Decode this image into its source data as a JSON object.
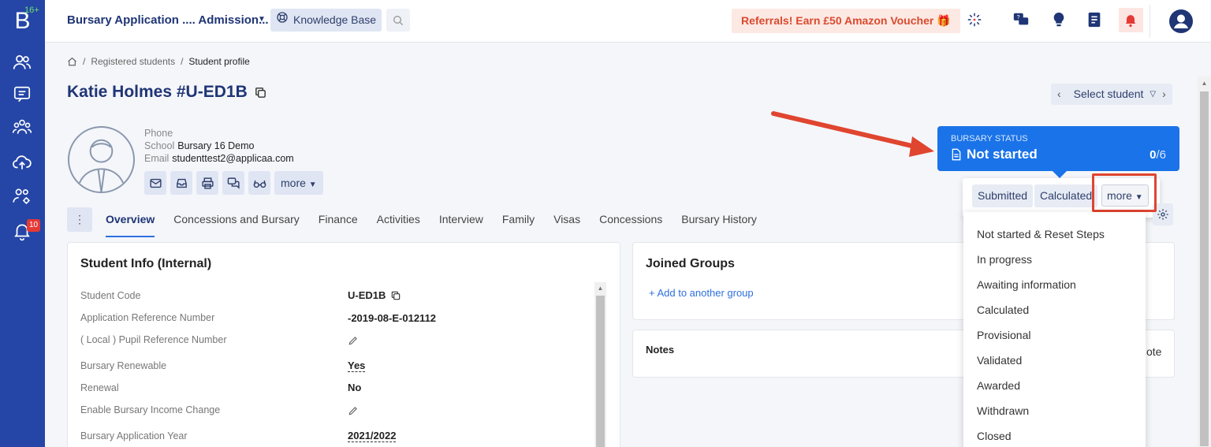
{
  "app": {
    "logo_letter": "B",
    "logo_super": "16+",
    "title": "Bursary Application .... Admission...",
    "kb_label": "Knowledge Base",
    "referral": "Referrals! Earn £50 Amazon Voucher",
    "notif_count": "10"
  },
  "breadcrumb": {
    "items": [
      "Registered students",
      "Student profile"
    ]
  },
  "student": {
    "name": "Katie Holmes #U-ED1B",
    "phone_label": "Phone",
    "school_label": "School",
    "school": "Bursary 16 Demo",
    "email_label": "Email",
    "email": "studenttest2@applicaa.com",
    "more_label": "more"
  },
  "select_student": "Select student",
  "tabs": [
    "Overview",
    "Concessions and Bursary",
    "Finance",
    "Activities",
    "Interview",
    "Family",
    "Visas",
    "Concessions",
    "Bursary History"
  ],
  "student_info": {
    "title": "Student Info (Internal)",
    "rows": [
      {
        "label": "Student Code",
        "value": "U-ED1B"
      },
      {
        "label": "Application Reference Number",
        "value": "-2019-08-E-012112"
      },
      {
        "label": "( Local ) Pupil Reference Number",
        "value": ""
      },
      {
        "label": "Bursary Renewable",
        "value": "Yes"
      },
      {
        "label": "Renewal",
        "value": "No"
      },
      {
        "label": "Enable Bursary Income Change",
        "value": ""
      },
      {
        "label": "Bursary Application Year",
        "value": "2021/2022"
      }
    ]
  },
  "groups": {
    "title": "Joined Groups",
    "add_label": "+ Add to another group"
  },
  "notes": {
    "title": "Notes",
    "partial": "ote"
  },
  "bursary": {
    "label": "BURSARY STATUS",
    "status": "Not started",
    "count": "0",
    "total": "/6",
    "chip_submitted": "Submitted",
    "chip_calculated": "Calculated",
    "more_label": "more",
    "menu": [
      "Not started & Reset Steps",
      "In progress",
      "Awaiting information",
      "Calculated",
      "Provisional",
      "Validated",
      "Awarded",
      "Withdrawn",
      "Closed"
    ]
  },
  "colors": {
    "rail": "#2546a6",
    "accent": "#1a73e8",
    "title": "#1f3575",
    "highlight": "#e0452f"
  }
}
